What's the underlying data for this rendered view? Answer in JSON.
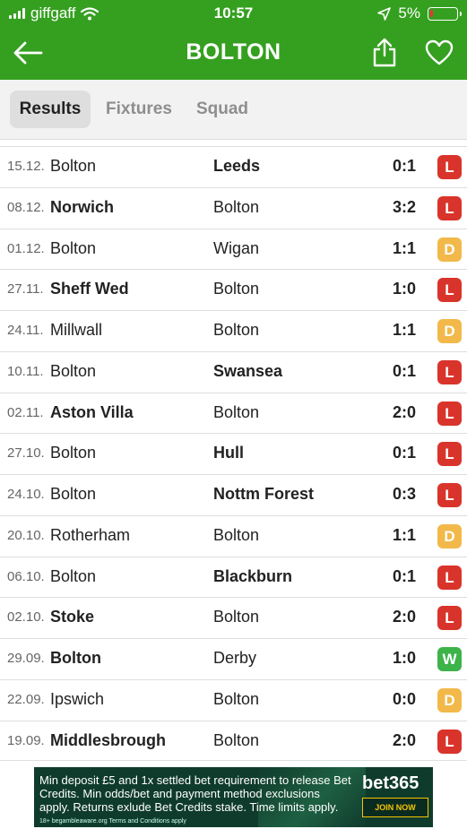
{
  "status_bar": {
    "carrier": "giffgaff",
    "time": "10:57",
    "battery": "5%",
    "battery_level": 0.05
  },
  "header": {
    "title": "BOLTON"
  },
  "tabs": [
    {
      "label": "Results",
      "active": true
    },
    {
      "label": "Fixtures",
      "active": false
    },
    {
      "label": "Squad",
      "active": false
    }
  ],
  "results": [
    {
      "date": "15.12.",
      "home": "Bolton",
      "away": "Leeds",
      "score": "0:1",
      "result": "L",
      "winner": "away"
    },
    {
      "date": "08.12.",
      "home": "Norwich",
      "away": "Bolton",
      "score": "3:2",
      "result": "L",
      "winner": "home"
    },
    {
      "date": "01.12.",
      "home": "Bolton",
      "away": "Wigan",
      "score": "1:1",
      "result": "D",
      "winner": ""
    },
    {
      "date": "27.11.",
      "home": "Sheff Wed",
      "away": "Bolton",
      "score": "1:0",
      "result": "L",
      "winner": "home"
    },
    {
      "date": "24.11.",
      "home": "Millwall",
      "away": "Bolton",
      "score": "1:1",
      "result": "D",
      "winner": ""
    },
    {
      "date": "10.11.",
      "home": "Bolton",
      "away": "Swansea",
      "score": "0:1",
      "result": "L",
      "winner": "away"
    },
    {
      "date": "02.11.",
      "home": "Aston Villa",
      "away": "Bolton",
      "score": "2:0",
      "result": "L",
      "winner": "home"
    },
    {
      "date": "27.10.",
      "home": "Bolton",
      "away": "Hull",
      "score": "0:1",
      "result": "L",
      "winner": "away"
    },
    {
      "date": "24.10.",
      "home": "Bolton",
      "away": "Nottm Forest",
      "score": "0:3",
      "result": "L",
      "winner": "away"
    },
    {
      "date": "20.10.",
      "home": "Rotherham",
      "away": "Bolton",
      "score": "1:1",
      "result": "D",
      "winner": ""
    },
    {
      "date": "06.10.",
      "home": "Bolton",
      "away": "Blackburn",
      "score": "0:1",
      "result": "L",
      "winner": "away"
    },
    {
      "date": "02.10.",
      "home": "Stoke",
      "away": "Bolton",
      "score": "2:0",
      "result": "L",
      "winner": "home"
    },
    {
      "date": "29.09.",
      "home": "Bolton",
      "away": "Derby",
      "score": "1:0",
      "result": "W",
      "winner": "home"
    },
    {
      "date": "22.09.",
      "home": "Ipswich",
      "away": "Bolton",
      "score": "0:0",
      "result": "D",
      "winner": ""
    },
    {
      "date": "19.09.",
      "home": "Middlesbrough",
      "away": "Bolton",
      "score": "2:0",
      "result": "L",
      "winner": "home"
    }
  ],
  "result_colors": {
    "L": "#d9342b",
    "D": "#f2b94a",
    "W": "#3db34a"
  },
  "ad": {
    "text": "Min deposit £5 and 1x settled bet requirement to release Bet Credits. Min odds/bet and payment method exclusions apply. Returns exlude Bet Credits stake. Time limits apply.",
    "brand": "bet365",
    "cta": "JOIN NOW",
    "footer": "18+ begambleaware.org  Terms and Conditions apply"
  },
  "colors": {
    "header_green": "#35a020"
  }
}
